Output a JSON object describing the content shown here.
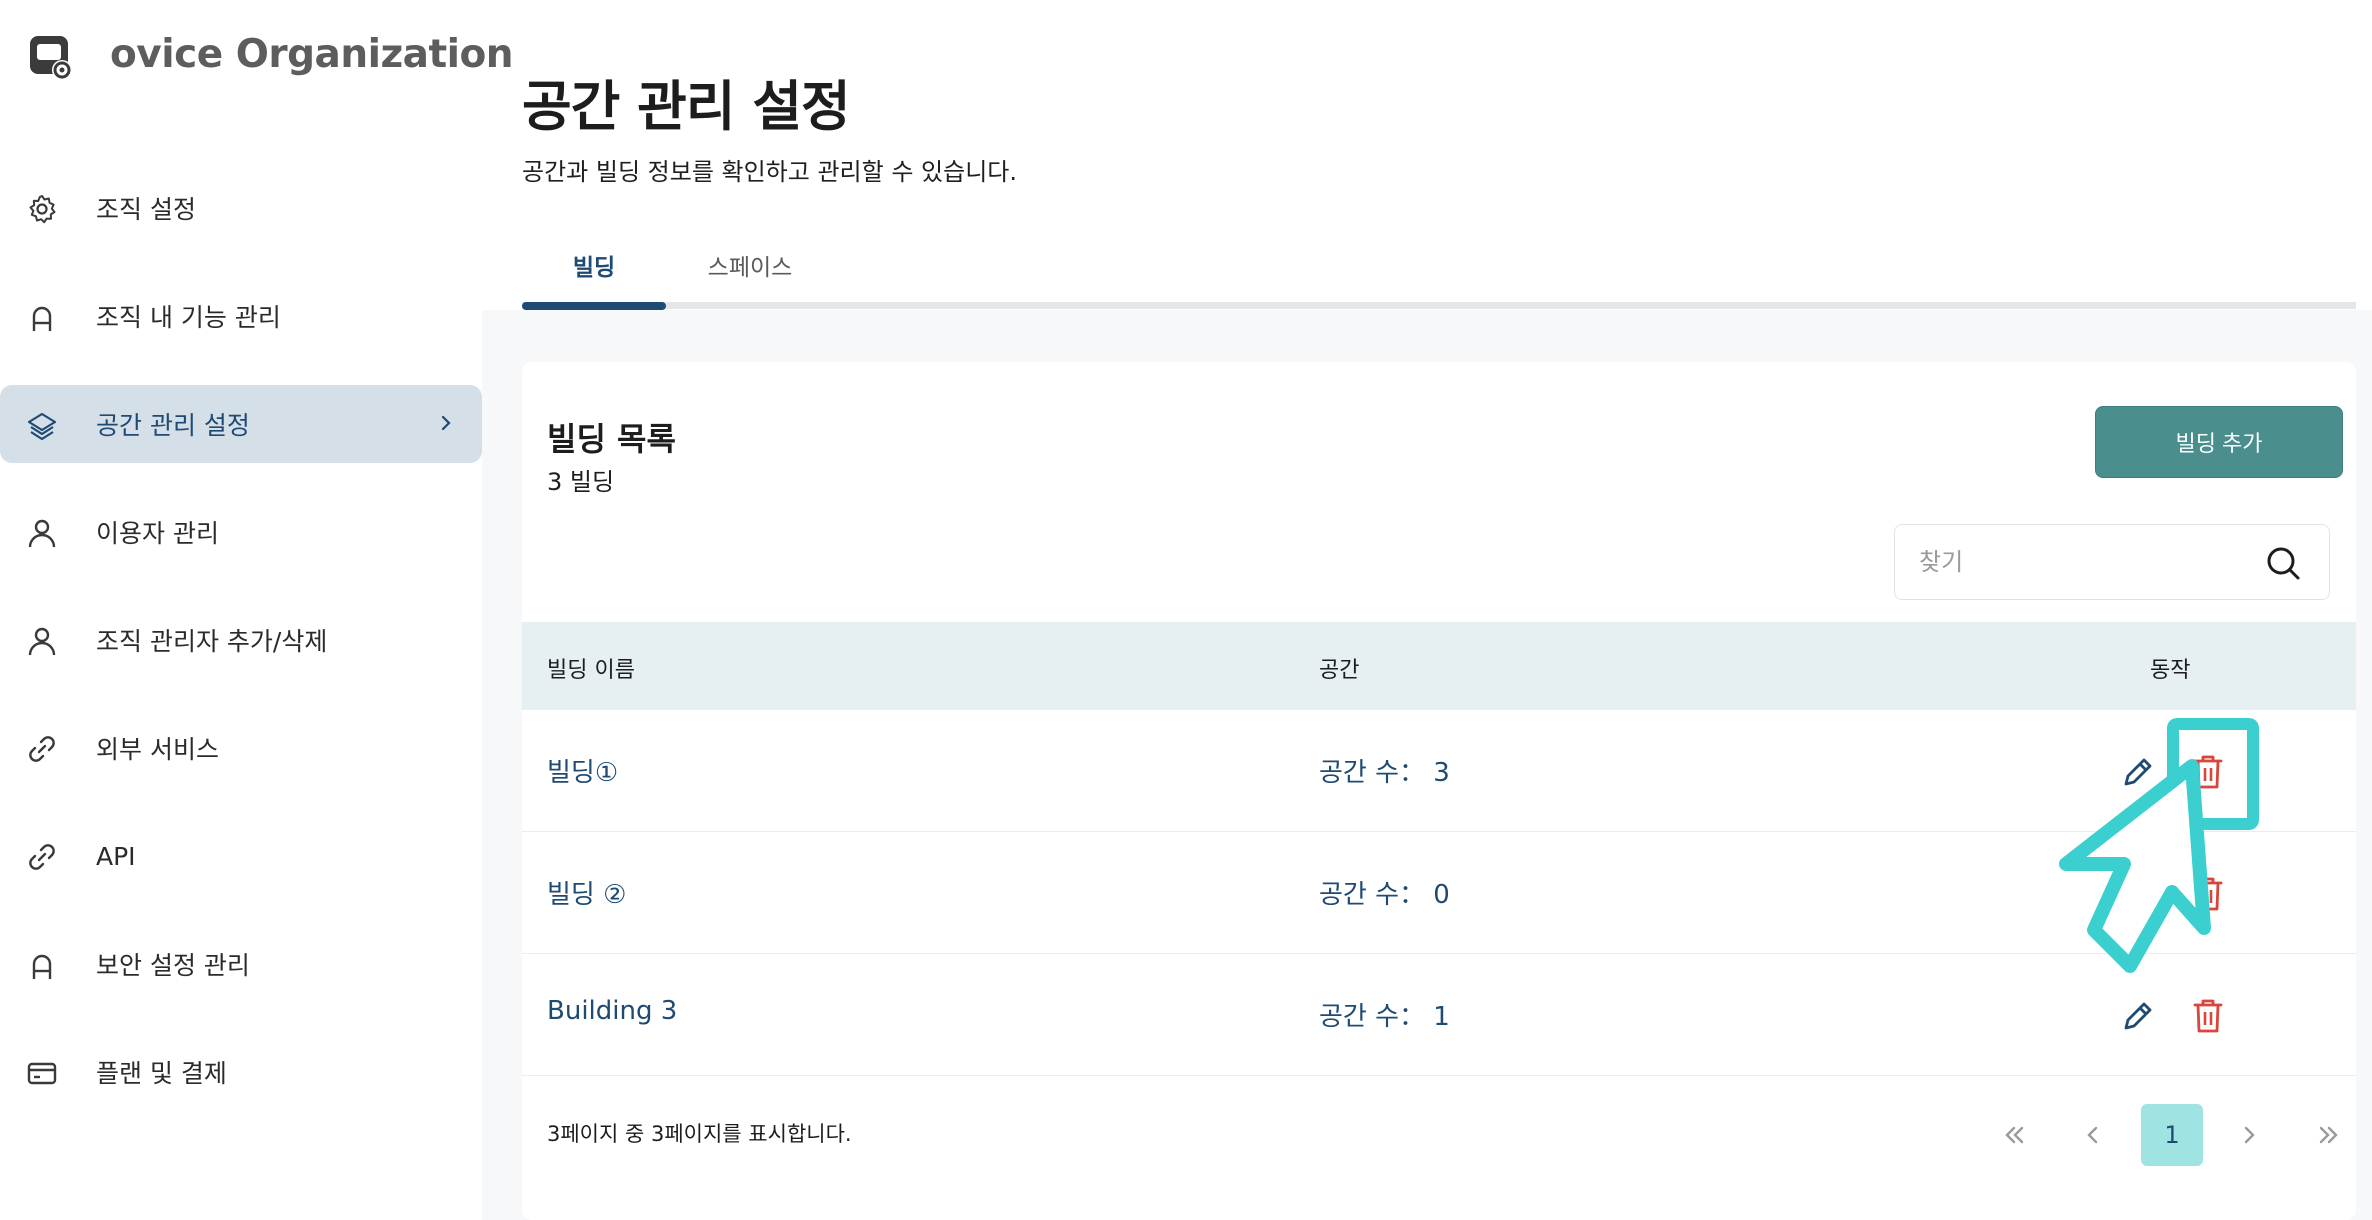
{
  "brand": {
    "name": "ovice Organization",
    "logo_icon": "ovice-logo-icon"
  },
  "sidebar": {
    "items": [
      {
        "label": "조직 설정",
        "icon": "gear-icon"
      },
      {
        "label": "조직 내 기능 관리",
        "icon": "lock-icon"
      },
      {
        "label": "공간 관리 설정",
        "icon": "layers-icon",
        "active": true
      },
      {
        "label": "이용자 관리",
        "icon": "user-icon"
      },
      {
        "label": "조직 관리자 추가/삭제",
        "icon": "user-icon"
      },
      {
        "label": "외부 서비스",
        "icon": "link-icon"
      },
      {
        "label": "API",
        "icon": "link-icon"
      },
      {
        "label": "보안 설정 관리",
        "icon": "lock-icon"
      },
      {
        "label": "플랜 및 결제",
        "icon": "credit-card-icon"
      }
    ]
  },
  "page": {
    "title": "공간 관리 설정",
    "subtitle": "공간과 빌딩 정보를 확인하고 관리할 수 있습니다."
  },
  "tabs": [
    {
      "label": "빌딩",
      "active": true
    },
    {
      "label": "스페이스",
      "active": false
    }
  ],
  "card": {
    "title": "빌딩 목록",
    "count": "3 빌딩",
    "add_button": "빌딩 추가",
    "search_placeholder": "찾기"
  },
  "table": {
    "headers": {
      "name": "빌딩 이름",
      "spaces": "공간",
      "actions": "동작"
    },
    "rows": [
      {
        "name": "빌딩①",
        "spaces": "공간 수： 3"
      },
      {
        "name": "빌딩 ②",
        "spaces": "공간 수： 0"
      },
      {
        "name": "Building 3",
        "spaces": "공간 수： 1"
      }
    ]
  },
  "pagination": {
    "summary": "3페이지 중 3페이지를 표시합니다.",
    "current_page": "1"
  },
  "colors": {
    "accent": "#1e4a73",
    "button": "#4a8e8e",
    "delete": "#d9453b",
    "highlight": "#3bcfcf",
    "active_nav": "#d5dfe8"
  }
}
